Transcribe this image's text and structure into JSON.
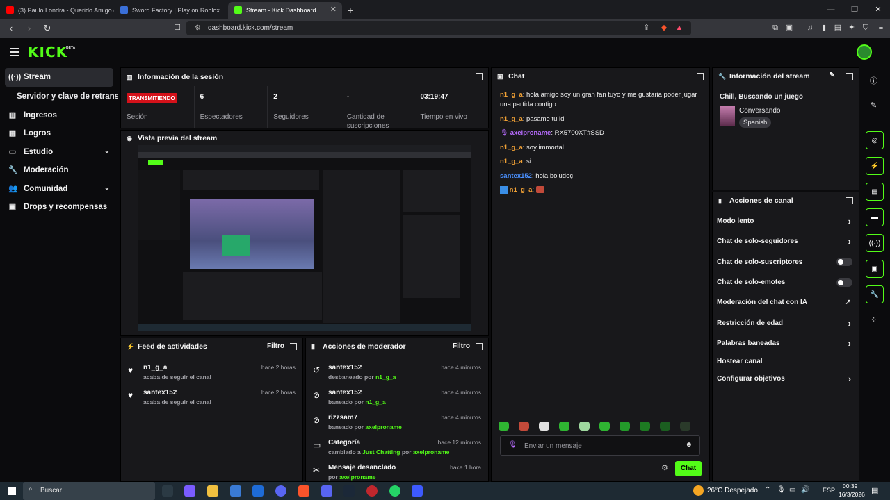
{
  "browser": {
    "tabs": [
      {
        "title": "(3) Paulo Londra - Querido Amigo (O",
        "color": "#ff0000"
      },
      {
        "title": "Sword Factory | Play on Roblox",
        "color": "#3a6fd8"
      },
      {
        "title": "Stream - Kick Dashboard",
        "color": "#53fc18"
      }
    ],
    "url": "dashboard.kick.com/stream"
  },
  "app": {
    "logo": "KICK",
    "beta": "BETA"
  },
  "sidebar": {
    "items": [
      {
        "label": "Stream",
        "icon": "antenna-icon"
      },
      {
        "label": "Servidor y clave de retransmisión",
        "icon": ""
      },
      {
        "label": "Ingresos",
        "icon": "chart-icon"
      },
      {
        "label": "Logros",
        "icon": "trophy-icon"
      },
      {
        "label": "Estudio",
        "icon": "studio-icon"
      },
      {
        "label": "Moderación",
        "icon": "wrench-icon"
      },
      {
        "label": "Comunidad",
        "icon": "people-icon"
      },
      {
        "label": "Drops y recompensas",
        "icon": "gift-icon"
      }
    ]
  },
  "session": {
    "title": "Información de la sesión",
    "badge": "TRANSMITIENDO",
    "stats": [
      {
        "value": "",
        "label": "Sesión"
      },
      {
        "value": "6",
        "label": "Espectadores"
      },
      {
        "value": "2",
        "label": "Seguidores"
      },
      {
        "value": "-",
        "label": "Cantidad de suscripciones"
      },
      {
        "value": "03:19:47",
        "label": "Tiempo en vivo"
      }
    ]
  },
  "preview": {
    "title": "Vista previa del stream"
  },
  "activity": {
    "title": "Feed de actividades",
    "filter": "Filtro",
    "items": [
      {
        "name": "n1_g_a",
        "action": "acaba de seguir el canal",
        "time": "hace 2 horas"
      },
      {
        "name": "santex152",
        "action": "acaba de seguir el canal",
        "time": "hace 2 horas"
      }
    ]
  },
  "modactions": {
    "title": "Acciones de moderador",
    "filter": "Filtro",
    "by": "por",
    "items": [
      {
        "name": "santex152",
        "action": "desbaneado",
        "target": "n1_g_a",
        "time": "hace 4 minutos",
        "icon": "unban-icon"
      },
      {
        "name": "santex152",
        "action": "baneado",
        "target": "n1_g_a",
        "time": "hace 4 minutos",
        "icon": "ban-icon"
      },
      {
        "name": "rizzsam7",
        "action": "baneado",
        "target": "axelproname",
        "time": "hace 4 minutos",
        "icon": "ban-icon"
      },
      {
        "name": "Categoría",
        "action": "cambiado a",
        "extra": "Just Chatting",
        "target": "axelproname",
        "time": "hace 12 minutos",
        "icon": "category-icon"
      },
      {
        "name": "Mensaje desanclado",
        "action": "",
        "target": "axelproname",
        "time": "hace 1 hora",
        "icon": "unpin-icon"
      }
    ]
  },
  "chat": {
    "title": "Chat",
    "messages": [
      {
        "user": "n1_g_a",
        "color": "#f0a035",
        "text": "hola amigo soy un gran fan tuyo y me gustaria poder jugar una partida contigo"
      },
      {
        "user": "n1_g_a",
        "color": "#f0a035",
        "text": "pasame tu id"
      },
      {
        "user": "axelproname",
        "color": "#b86cff",
        "text": "RX5700XT#SSD"
      },
      {
        "user": "n1_g_a",
        "color": "#f0a035",
        "text": "soy immortal"
      },
      {
        "user": "n1_g_a",
        "color": "#f0a035",
        "text": "si"
      },
      {
        "user": "santex152",
        "color": "#4a90ff",
        "text": "hola boludoç"
      },
      {
        "user": "n1_g_a",
        "color": "#f0a035",
        "text": ""
      }
    ],
    "placeholder": "Enviar un mensaje",
    "send": "Chat"
  },
  "streaminfo": {
    "title": "Información del stream",
    "stream_title": "Chill, Buscando un juego",
    "category": "Conversando",
    "language": "Spanish"
  },
  "channel": {
    "title": "Acciones de canal",
    "items": [
      {
        "label": "Modo lento",
        "type": "arrow"
      },
      {
        "label": "Chat de solo-seguidores",
        "type": "arrow"
      },
      {
        "label": "Chat de solo-suscriptores",
        "type": "toggle"
      },
      {
        "label": "Chat de solo-emotes",
        "type": "toggle"
      },
      {
        "label": "Moderación del chat con IA",
        "type": "external"
      },
      {
        "label": "Restricción de edad",
        "type": "arrow"
      },
      {
        "label": "Palabras baneadas",
        "type": "arrow"
      },
      {
        "label": "Hostear canal",
        "type": "none"
      },
      {
        "label": "Configurar objetivos",
        "type": "arrow"
      }
    ]
  },
  "taskbar": {
    "search": "Buscar",
    "weather": "26°C  Despejado",
    "lang": "ESP",
    "time": "00:39",
    "date": "16/3/2026"
  }
}
